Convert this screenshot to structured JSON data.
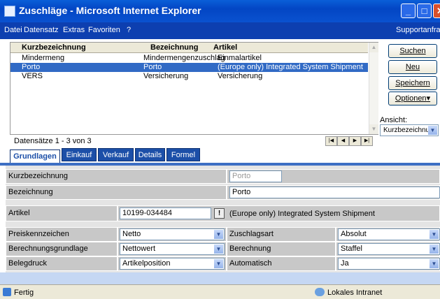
{
  "window": {
    "title": "Zuschläge - Microsoft Internet Explorer"
  },
  "menu": {
    "items": [
      "Datei",
      "Datensatz",
      "Extras",
      "Favoriten",
      "?"
    ],
    "right": "Supportanfrage"
  },
  "list": {
    "columns": [
      "Kurzbezeichnung",
      "Bezeichnung",
      "Artikel"
    ],
    "rows": [
      [
        "Mindermeng",
        "Mindermengenzuschlag",
        "Einmalartikel"
      ],
      [
        "Porto",
        "Porto",
        "(Europe only) Integrated System Shipment"
      ],
      [
        "VERS",
        "Versicherung",
        "Versicherung"
      ]
    ],
    "selected_row": 1,
    "record_info": "Datensätze 1 - 3 von 3"
  },
  "buttons": {
    "search": "Suchen",
    "new": "Neu",
    "save": "Speichern",
    "options": "Optionen"
  },
  "view": {
    "label": "Ansicht:",
    "value": "Kurzbezeichnung"
  },
  "tabs": [
    "Grundlagen",
    "Einkauf",
    "Verkauf",
    "Details",
    "Formel"
  ],
  "active_tab": "Grundlagen",
  "form": {
    "kurzbezeichnung": {
      "label": "Kurzbezeichnung",
      "value": "Porto"
    },
    "bezeichnung": {
      "label": "Bezeichnung",
      "value": "Porto"
    },
    "artikel": {
      "label": "Artikel",
      "value": "10199-034484",
      "description": "(Europe only) Integrated System Shipment",
      "lookup_icon": "!"
    },
    "preiskennzeichen": {
      "label": "Preiskennzeichen",
      "value": "Netto"
    },
    "zuschlagsart": {
      "label": "Zuschlagsart",
      "value": "Absolut"
    },
    "berechnungsgrundlage": {
      "label": "Berechnungsgrundlage",
      "value": "Nettowert"
    },
    "berechnung": {
      "label": "Berechnung",
      "value": "Staffel"
    },
    "belegdruck": {
      "label": "Belegdruck",
      "value": "Artikelposition"
    },
    "automatisch": {
      "label": "Automatisch",
      "value": "Ja"
    }
  },
  "status": {
    "left": "Fertig",
    "zone": "Lokales Intranet"
  },
  "colors": {
    "titlebar": "#0346c4",
    "selection": "#316ac5",
    "tab": "#1c4fa8",
    "form_label_bg": "#c8c8c8"
  }
}
